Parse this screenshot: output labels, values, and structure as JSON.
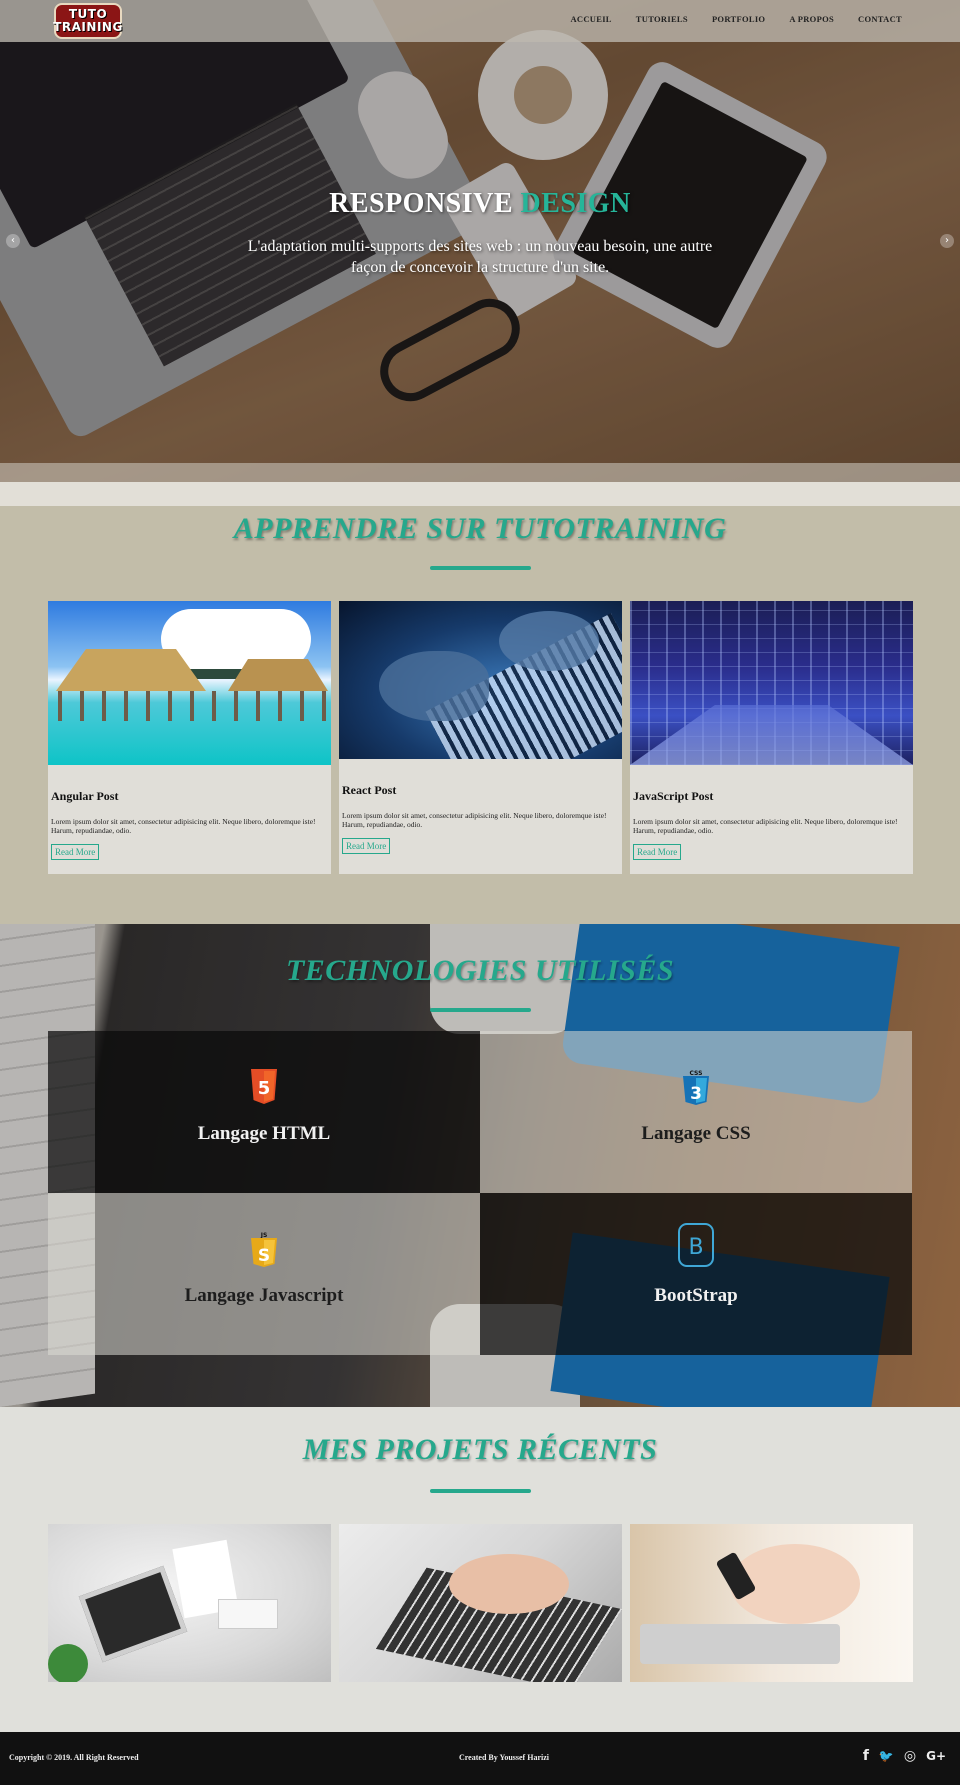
{
  "brand": {
    "logo_line1": "TUTO",
    "logo_line2": "TRAINING"
  },
  "nav": {
    "items": [
      "ACCUEIL",
      "TUTORIELS",
      "PORTFOLIO",
      "A PROPOS",
      "CONTACT"
    ]
  },
  "hero": {
    "title_main": "RESPONSIVE",
    "title_accent": "DESIGN",
    "subtitle": "L'adaptation multi-supports des sites web : un nouveau besoin, une autre façon de concevoir la structure d'un site.",
    "prev_icon": "chevron-left-icon",
    "next_icon": "chevron-right-icon"
  },
  "learn": {
    "title": "APPRENDRE SUR TUTOTRAINING",
    "cards": [
      {
        "title": "Angular Post",
        "text": "Lorem ipsum dolor sit amet, consectetur adipisicing elit. Neque libero, doloremque iste! Harum, repudiandae, odio.",
        "button": "Read More"
      },
      {
        "title": "React Post",
        "text": "Lorem ipsum dolor sit amet, consectetur adipisicing elit. Neque libero, doloremque iste! Harum, repudiandae, odio.",
        "button": "Read More"
      },
      {
        "title": "JavaScript Post",
        "text": "Lorem ipsum dolor sit amet, consectetur adipisicing elit. Neque libero, doloremque iste! Harum, repudiandae, odio.",
        "button": "Read More"
      }
    ]
  },
  "tech": {
    "title": "TECHNOLOGIES UTILISÉS",
    "items": [
      {
        "label": "Langage HTML",
        "icon": "html5-icon",
        "badge": "5",
        "color": "#e44d26"
      },
      {
        "label": "Langage CSS",
        "icon": "css3-icon",
        "badge": "3",
        "top_text": "CSS",
        "color": "#1572b6"
      },
      {
        "label": "Langage Javascript",
        "icon": "javascript-icon",
        "badge": "S",
        "top_text": "JS",
        "color": "#e7a918"
      },
      {
        "label": "BootStrap",
        "icon": "bootstrap-icon",
        "badge": "B",
        "color": "#3fa7d6"
      }
    ]
  },
  "projects": {
    "title": "MES PROJETS RÉCENTS"
  },
  "footer": {
    "copyright": "Copyright © 2019. All Right Reserved",
    "credit": "Created By Youssef Harizi",
    "social": [
      {
        "icon": "facebook-icon",
        "glyph": "f"
      },
      {
        "icon": "twitter-icon",
        "glyph": "🐦"
      },
      {
        "icon": "instagram-icon",
        "glyph": "◎"
      },
      {
        "icon": "google-plus-icon",
        "glyph": "G+"
      }
    ]
  },
  "colors": {
    "accent": "#26a88c",
    "section_bg": "#c2bda9",
    "footer_bg": "#111111"
  }
}
